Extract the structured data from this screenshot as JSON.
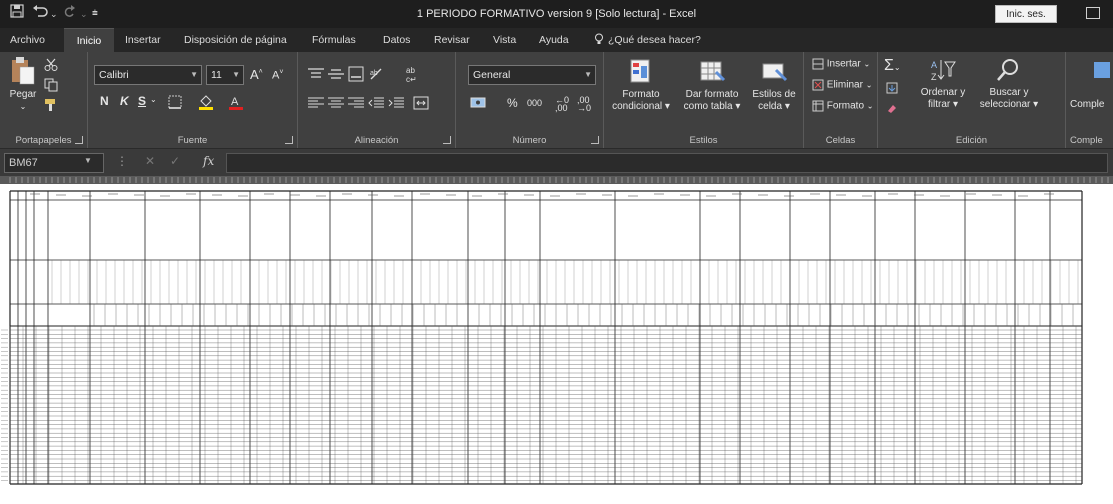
{
  "window": {
    "title": "1 PERIODO FORMATIVO version 9  [Solo lectura]  -  Excel",
    "signin_label": "Inic. ses."
  },
  "quick_access": {
    "save_icon": "save-icon",
    "undo_icon": "undo-icon",
    "redo_icon": "redo-icon",
    "customize_icon": "customize-icon"
  },
  "tabs": [
    {
      "label": "Archivo"
    },
    {
      "label": "Inicio",
      "active": true
    },
    {
      "label": "Insertar"
    },
    {
      "label": "Disposición de página"
    },
    {
      "label": "Fórmulas"
    },
    {
      "label": "Datos"
    },
    {
      "label": "Revisar"
    },
    {
      "label": "Vista"
    },
    {
      "label": "Ayuda"
    }
  ],
  "tell_me": "¿Qué desea hacer?",
  "ribbon": {
    "clipboard": {
      "paste_label": "Pegar",
      "group_label": "Portapapeles"
    },
    "font": {
      "family": "Calibri",
      "size": "11",
      "bold": "N",
      "italic": "K",
      "underline": "S",
      "group_label": "Fuente"
    },
    "alignment": {
      "group_label": "Alineación"
    },
    "number": {
      "format": "General",
      "percent": "%",
      "thousands": "000",
      "group_label": "Número"
    },
    "styles": {
      "conditional": [
        "Formato",
        "condicional ▾"
      ],
      "as_table": [
        "Dar formato",
        "como tabla ▾"
      ],
      "cell_styles": [
        "Estilos de",
        "celda ▾"
      ],
      "group_label": "Estilos"
    },
    "cells": {
      "insert": "Insertar",
      "delete": "Eliminar",
      "format": "Formato",
      "group_label": "Celdas"
    },
    "editing": {
      "sort": [
        "Ordenar y",
        "filtrar ▾"
      ],
      "find": [
        "Buscar y",
        "seleccionar ▾"
      ],
      "group_label": "Edición"
    },
    "addins": {
      "label": "Comple",
      "group_label": "Comple"
    }
  },
  "formula_bar": {
    "name_box": "BM67",
    "fx": "fx",
    "value": ""
  }
}
